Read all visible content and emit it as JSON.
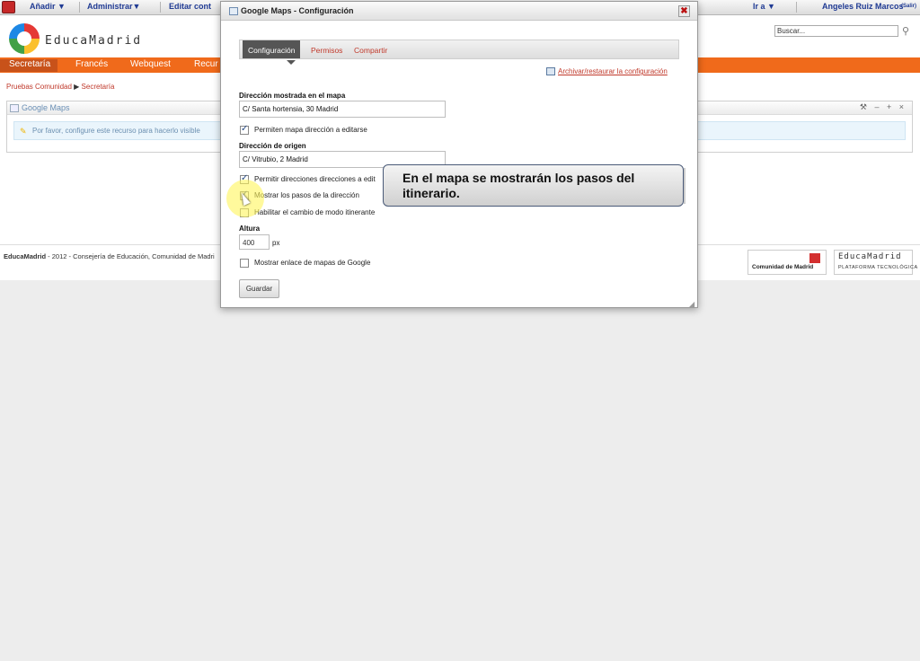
{
  "dockbar": {
    "add": "Añadir ▼",
    "manage": "Administrar▼",
    "edit": "Editar cont",
    "goto": "Ir a ▼",
    "user": "Angeles Ruiz Marcos",
    "logout": "(Salir)"
  },
  "header": {
    "logo": "EducaMadrid",
    "search_placeholder": "Buscar..."
  },
  "nav": {
    "items": [
      "Secretaría",
      "Francés",
      "Webquest",
      "Recur"
    ]
  },
  "breadcrumb": {
    "items": [
      "Pruebas Comunidad",
      "Secretaría"
    ]
  },
  "portlet": {
    "title": "Google Maps",
    "controls": "⚒ – + ×",
    "message": "Por favor, configure este recurso para hacerlo visible"
  },
  "footer": {
    "brand": "EducaMadrid",
    "text": " - 2012 - Consejería de Educación, Comunidad de Madri",
    "cm_logo": "Comunidad de Madrid",
    "em_logo": "EducaMadrid",
    "em_sub": "PLATAFORMA TECNOLÓGICA"
  },
  "dialog": {
    "title": "Google Maps - Configuración",
    "close": "✖",
    "tabs": [
      "Configuración",
      "Permisos",
      "Compartir"
    ],
    "archive_link": "Archivar/restaurar la configuración",
    "label_address": "Dirección mostrada en el mapa",
    "value_address": "C/ Santa hortensia, 30 Madrid",
    "cb_allow_edit": "Permiten mapa dirección a editarse",
    "label_origin": "Dirección de origen",
    "value_origin": "C/ Vitrubio, 2 Madrid",
    "cb_allow_dirs": "Permitir direcciones direcciones a edit",
    "cb_show_steps": "Mostrar los pasos de la dirección",
    "cb_travel_mode": "Habilitar el cambio de modo itinerante",
    "label_height": "Altura",
    "value_height": "400",
    "unit_height": "px",
    "cb_google_link": "Mostrar enlace de mapas de Google",
    "save": "Guardar"
  },
  "tooltip": {
    "text": "En el mapa se mostrarán los pasos del itinerario."
  }
}
